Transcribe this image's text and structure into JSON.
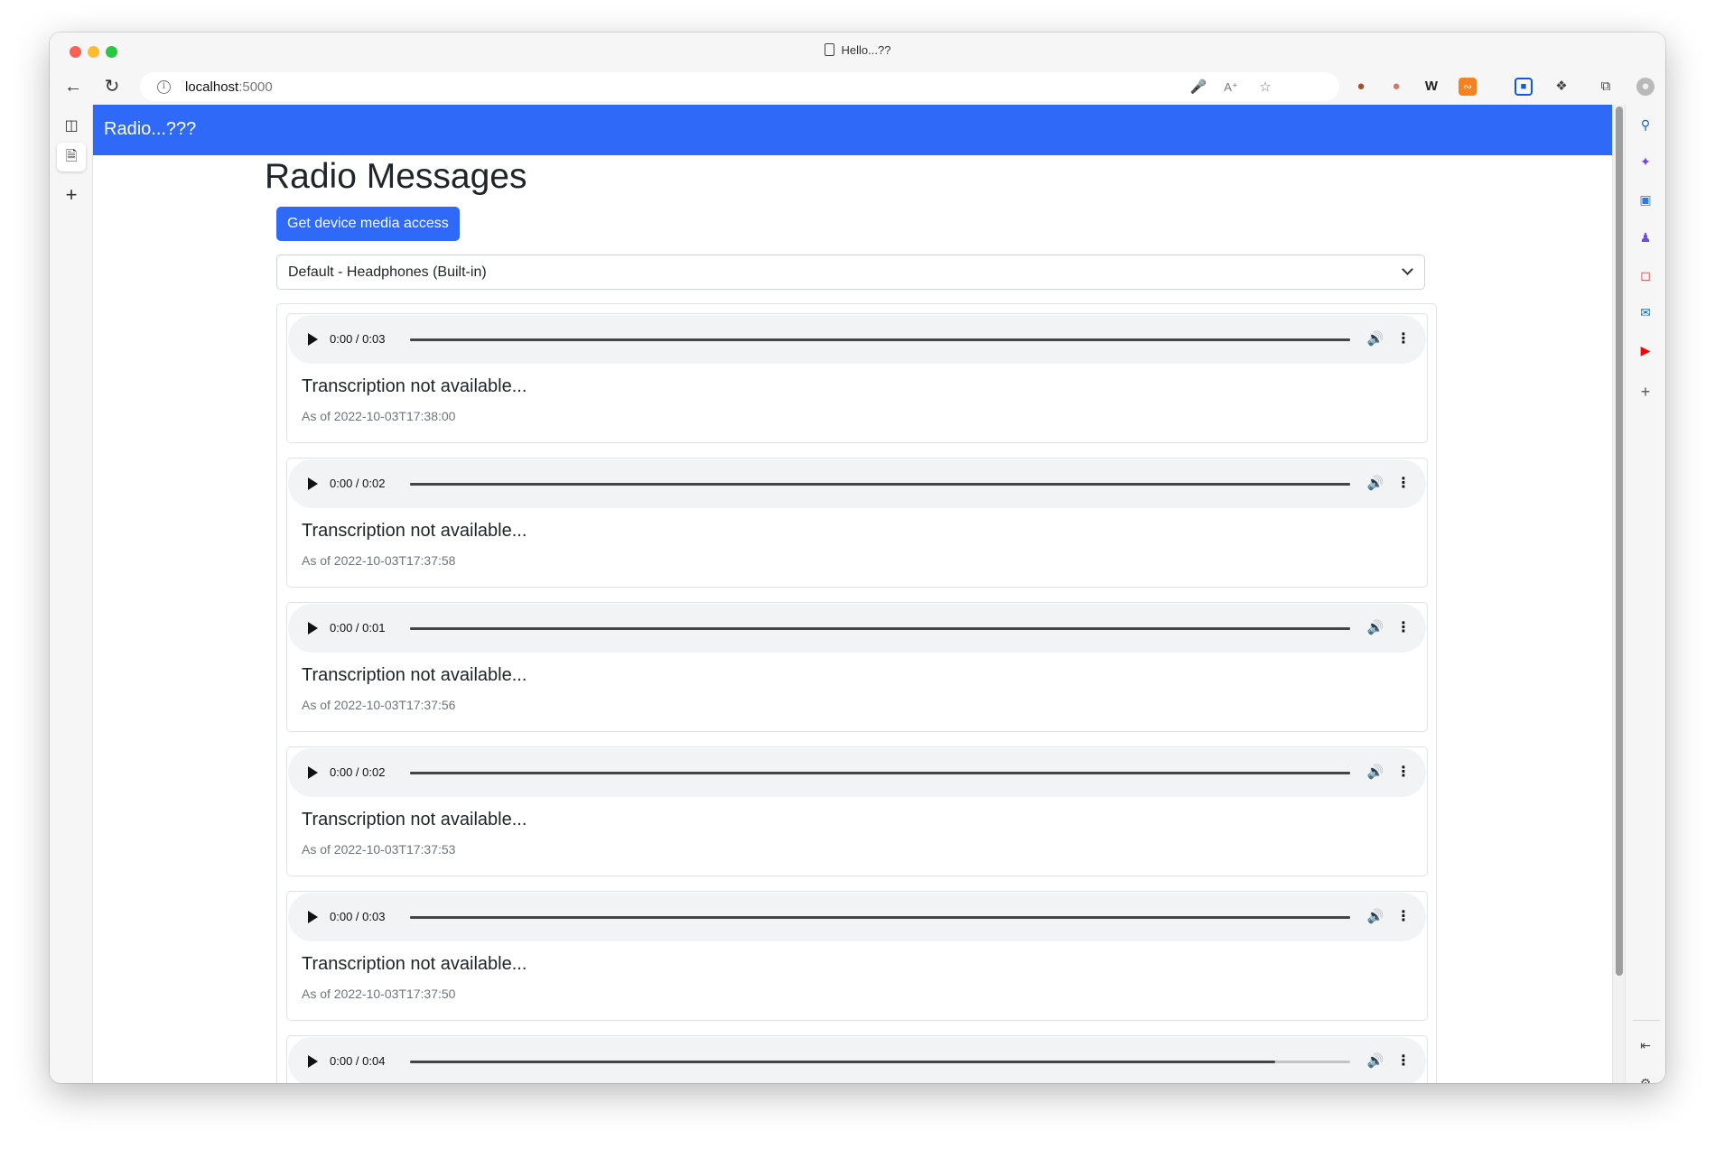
{
  "window": {
    "tab_title": "Hello...??"
  },
  "toolbar": {
    "url_host": "localhost",
    "url_port": ":5000",
    "icons": [
      "back-icon",
      "refresh-icon",
      "info-icon",
      "microphone-icon",
      "read-aloud-icon",
      "add-favorite-icon",
      "extension-icon",
      "extension-icon",
      "extension-icon",
      "rss-icon",
      "extension-icon",
      "extensions-puzzle-icon",
      "collections-icon",
      "profile-avatar",
      "more-icon"
    ]
  },
  "right_sidebar": {
    "icons": [
      "search-icon",
      "copilot-icon",
      "tools-icon",
      "games-icon",
      "office-icon",
      "outlook-icon",
      "youtube-icon",
      "add-icon",
      "hide-sidebar-icon",
      "settings-icon"
    ]
  },
  "app": {
    "brand": "Radio...???",
    "page_title": "Radio Messages",
    "media_button_label": "Get device media access",
    "device_select_value": "Default - Headphones (Built-in)",
    "accent_color": "#2f69f7"
  },
  "messages": [
    {
      "time": "0:00 / 0:03",
      "transcription": "Transcription not available...",
      "as_of": "As of 2022-10-03T17:38:00",
      "played_fraction": 1.0
    },
    {
      "time": "0:00 / 0:02",
      "transcription": "Transcription not available...",
      "as_of": "As of 2022-10-03T17:37:58",
      "played_fraction": 1.0
    },
    {
      "time": "0:00 / 0:01",
      "transcription": "Transcription not available...",
      "as_of": "As of 2022-10-03T17:37:56",
      "played_fraction": 1.0
    },
    {
      "time": "0:00 / 0:02",
      "transcription": "Transcription not available...",
      "as_of": "As of 2022-10-03T17:37:53",
      "played_fraction": 1.0
    },
    {
      "time": "0:00 / 0:03",
      "transcription": "Transcription not available...",
      "as_of": "As of 2022-10-03T17:37:50",
      "played_fraction": 1.0
    },
    {
      "time": "0:00 / 0:04",
      "transcription": "",
      "as_of": "",
      "played_fraction": 0.92
    }
  ]
}
